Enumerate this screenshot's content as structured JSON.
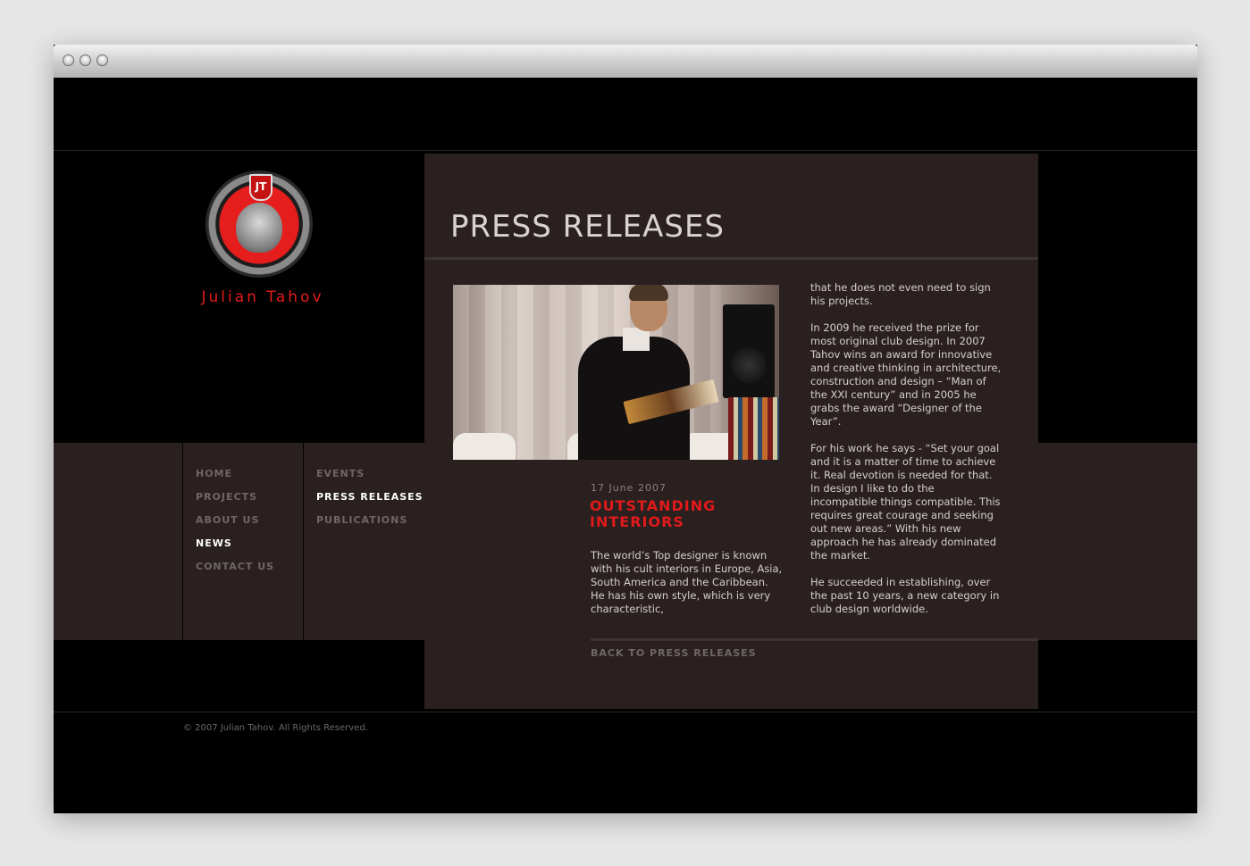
{
  "window": {
    "controls": [
      "close",
      "minimize",
      "zoom"
    ]
  },
  "brand": {
    "name": "Julian Tahov",
    "logo_monogram": "JT",
    "logo_icon": "medusa-medallion-icon",
    "accent_color": "#e31b1b"
  },
  "nav": {
    "primary": [
      {
        "label": "HOME",
        "active": false
      },
      {
        "label": "PROJECTS",
        "active": false
      },
      {
        "label": "ABOUT US",
        "active": false
      },
      {
        "label": "NEWS",
        "active": true
      },
      {
        "label": "CONTACT US",
        "active": false
      }
    ],
    "secondary": [
      {
        "label": "EVENTS",
        "active": false
      },
      {
        "label": "PRESS RELEASES",
        "active": true
      },
      {
        "label": "PUBLICATIONS",
        "active": false
      }
    ]
  },
  "main": {
    "title": "PRESS RELEASES",
    "article": {
      "date": "17 June 2007",
      "headline": "OUTSTANDING INTERIORS",
      "col1": "The world’s Top designer is known with his cult interiors in Europe, Asia, South America and the Caribbean. He has his own style, which is very characteristic,",
      "col2": [
        "that he does not even need to sign his projects.",
        "In 2009 he received the prize for most original club design. In 2007 Tahov wins an award for innovative and creative thinking in architecture, construction and design – “Man of the XXI century” and in 2005 he grabs the award “Designer of the Year”.",
        "For his work he says - “Set your goal and it is a matter of time to achieve it. Real devotion is needed for that. In design I like to do the incompatible things compatible. This requires great courage and seeking out new areas.” With his new approach he has already dominated the market.",
        "He succeeded in establishing, over the past 10 years, a new category in club design worldwide."
      ]
    },
    "back_link": "BACK TO PRESS RELEASES"
  },
  "footer": {
    "copyright": "© 2007 Julian Tahov. All Rights Reserved."
  },
  "colors": {
    "background": "#000000",
    "panel": "#2a2020",
    "nav_text": "#6f6666",
    "nav_active": "#ffffff",
    "headline": "#e01a1a"
  }
}
